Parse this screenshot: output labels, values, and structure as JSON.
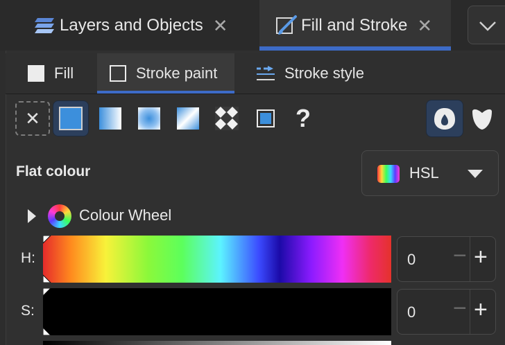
{
  "tabs": [
    {
      "label": "Layers and Objects",
      "icon": "layers-icon",
      "active": false
    },
    {
      "label": "Fill and Stroke",
      "icon": "paint-brush-icon",
      "active": true
    }
  ],
  "subtabs": [
    {
      "label": "Fill",
      "icon": "fill-square-icon",
      "active": false
    },
    {
      "label": "Stroke paint",
      "icon": "stroke-square-icon",
      "active": true
    },
    {
      "label": "Stroke style",
      "icon": "stroke-style-icon",
      "active": false
    }
  ],
  "paint_types": [
    "no-paint",
    "flat-colour",
    "linear-gradient",
    "radial-gradient",
    "mesh-gradient",
    "pattern",
    "swatch",
    "unset"
  ],
  "selected_paint_type": "flat-colour",
  "fill_rules": [
    "evenodd",
    "nonzero"
  ],
  "section_title": "Flat colour",
  "colour_mode": {
    "label": "HSL"
  },
  "colour_wheel": {
    "label": "Colour Wheel",
    "expanded": false
  },
  "channels": [
    {
      "label": "H:",
      "value": "0"
    },
    {
      "label": "S:",
      "value": "0"
    }
  ],
  "spin_minus": "−",
  "spin_plus": "+",
  "colors": {
    "accent": "#3d6bc7",
    "selected_bg": "#2c3f5c",
    "flat_blue": "#3c8fdc"
  }
}
